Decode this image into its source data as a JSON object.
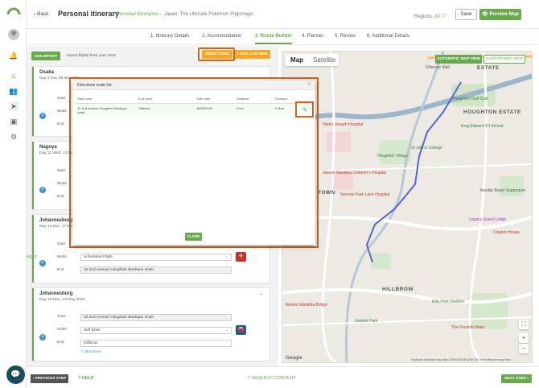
{
  "header": {
    "back_label": "Back",
    "title": "Personal itinerary",
    "breadcrumb_1": "Personal Itineraries",
    "breadcrumb_sep": "›",
    "breadcrumb_2": "Japan: The Ultimate Pokemon Pilgrimage",
    "regions_label": "Regions:",
    "regions_value": "All",
    "save_label": "Save",
    "preview_label": "Preview Map"
  },
  "steps": [
    "1. Itinerary Details",
    "2. Accommodation",
    "3. Route Builder",
    "4. Planner",
    "5. Review",
    "6. Additional Details"
  ],
  "toolbar": {
    "gds_label": "GDS IMPORT",
    "gds_text": "Import flights from your GDS",
    "directions_label": "DIRECTIONS",
    "car_hire_label": "+ ADD CAR HIRE"
  },
  "days": [
    {
      "city": "Osaka",
      "date": "Day 6 Sat, 09 May 202"
    },
    {
      "city": "Nagoya",
      "date": "Day 10 Wed, 13 May 2"
    },
    {
      "city": "Johannesburg",
      "date": "Day 14 Sun, 17 May 2"
    },
    {
      "city": "Johannesburg",
      "date": "Day 15 Mon, 18 May 2026"
    }
  ],
  "labels": {
    "start": "Start",
    "mode": "Mode",
    "end": "End",
    "help_tag": "HELP"
  },
  "day3": {
    "mode": "Scheduled Flight",
    "end": "10 2nd Avenue Houghton Boutique Hotel"
  },
  "day4": {
    "start": "10 2nd Avenue Houghton Boutique Hotel",
    "mode": "Self Drive",
    "end": "Hillbrow",
    "directions_link": "directions"
  },
  "modal": {
    "title": "Directions route list",
    "columns": [
      "Start point",
      "End point",
      "Start date",
      "Distance",
      "Duration"
    ],
    "rows": [
      {
        "start": "10 2nd Avenue Houghton Boutique Hotel",
        "end": "Hillbrow",
        "date": "18/05/2026",
        "distance": "3 km",
        "duration": "0.9hrs"
      }
    ],
    "close_label": "CLOSE"
  },
  "map": {
    "tab_map": "Map",
    "tab_satellite": "Satellite",
    "auto_view": "AUTOMATIC MAP VIEW",
    "custom_view": "CUSTOM MAP VIEW",
    "labels": [
      "Killarney Mall",
      "ESTATE",
      "Houghton Golf Club",
      "HOUGHTON ESTATE",
      "King Edward VII School",
      "Helen Joseph Hospital",
      "Nelson Mandela Children's Hospital",
      "Houghton Village",
      "St John's College",
      "TOWN",
      "Yeoville Boxer Superstore",
      "Netcare Park Lane Hospital",
      "Legacy Guest Lodge",
      "Clayton House",
      "HILLBROW",
      "Ellis Park Stadium",
      "Nelson Mandela Bridge",
      "Joubert Park",
      "The Fireside Hotel"
    ],
    "footer": "Keyboard shortcuts   Map data ©2026 AfriGIS (Pty) Ltd   Terms   Report a map error",
    "google": "Google"
  },
  "footer": {
    "previous_label": "PREVIOUS STEP",
    "help_label": "HELP",
    "request_label": "REQUEST CONTENT",
    "next_label": "NEXT STEP"
  },
  "colors": {
    "green": "#6aa84f",
    "orange": "#f5a623",
    "highlight": "#c86522",
    "blue": "#3f8fd8",
    "red": "#c9302c"
  }
}
